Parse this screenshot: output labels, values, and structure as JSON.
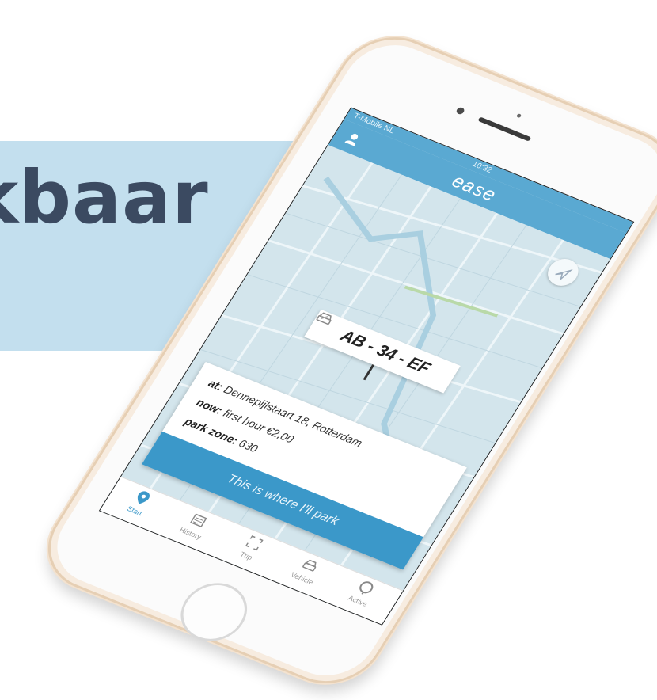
{
  "banner": {
    "text": "kbaar"
  },
  "status_bar": {
    "carrier": "T-Mobile NL",
    "time": "10:32"
  },
  "app_bar": {
    "logo": "ease"
  },
  "plate_select": {
    "value": "AB - 34 - EF"
  },
  "info_card": {
    "address_label": "at:",
    "address_value": " Dennepijlstaart 18, Rotterdam",
    "price_label": "now:",
    "price_value": " first hour €2,00",
    "zone_label": "park zone:",
    "zone_value": " 630",
    "button_label": "This is where I'll park"
  },
  "tabs": [
    {
      "label": "Start",
      "icon": "map-pin-icon",
      "active": true
    },
    {
      "label": "History",
      "icon": "history-icon",
      "active": false
    },
    {
      "label": "Trip",
      "icon": "trip-icon",
      "active": false
    },
    {
      "label": "Vehicle",
      "icon": "car-icon",
      "active": false
    },
    {
      "label": "Active",
      "icon": "active-parking-icon",
      "active": false
    }
  ],
  "colors": {
    "banner": "#c3dfee",
    "banner_text": "#3b4a61",
    "accent": "#3b98c9",
    "app_bar": "#5aa9d2",
    "map": "#d3e5ec"
  }
}
